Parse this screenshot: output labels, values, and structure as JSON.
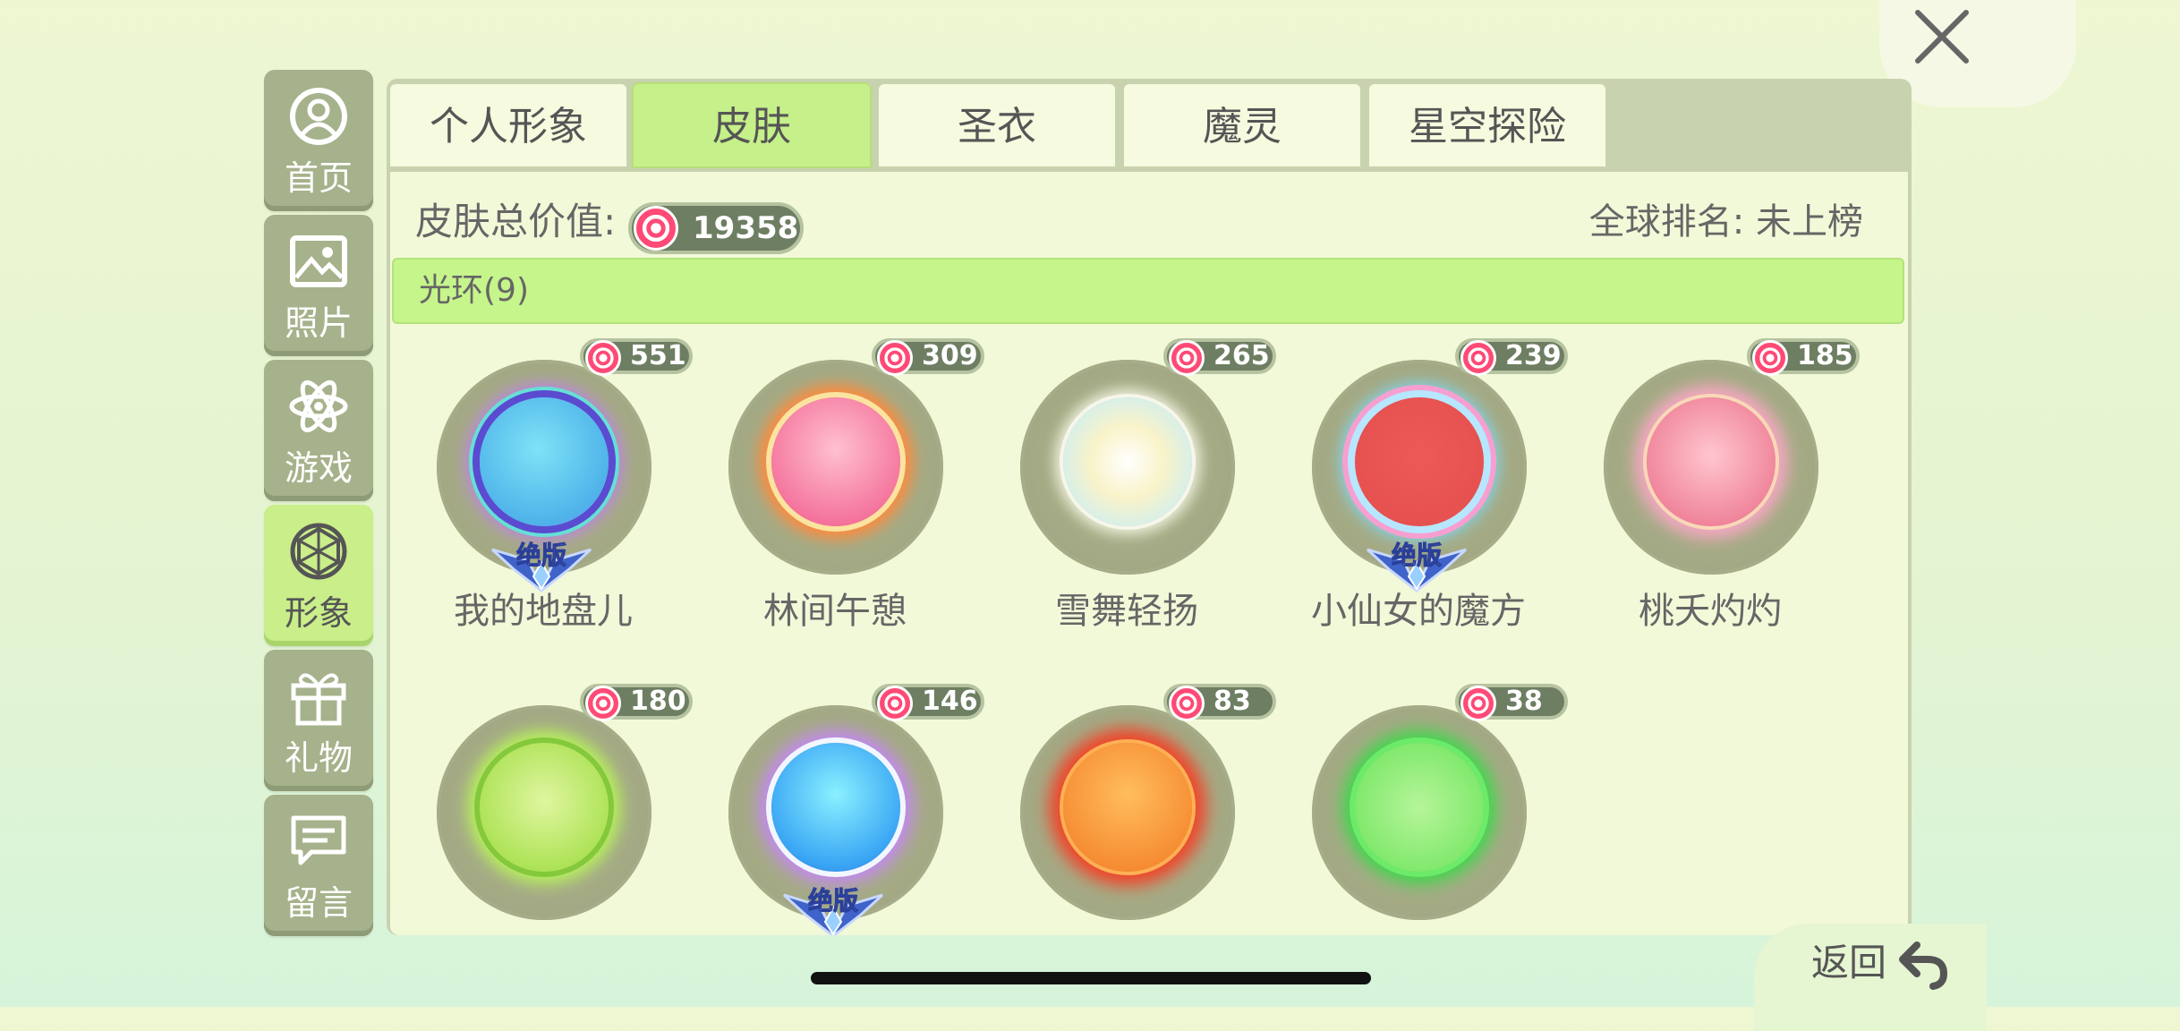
{
  "sidebar": {
    "items": [
      {
        "label": "首页",
        "icon": "user-circle-icon"
      },
      {
        "label": "照片",
        "icon": "photo-icon"
      },
      {
        "label": "游戏",
        "icon": "atom-icon"
      },
      {
        "label": "形象",
        "icon": "gem-icon",
        "active": true
      },
      {
        "label": "礼物",
        "icon": "gift-icon"
      },
      {
        "label": "留言",
        "icon": "message-icon"
      }
    ]
  },
  "tabs": [
    {
      "label": "个人形象"
    },
    {
      "label": "皮肤",
      "active": true
    },
    {
      "label": "圣衣"
    },
    {
      "label": "魔灵"
    },
    {
      "label": "星空探险"
    }
  ],
  "summary": {
    "total_label": "皮肤总价值:",
    "total_value": "19358",
    "rank_text": "全球排名: 未上榜"
  },
  "section": {
    "title": "光环(9)"
  },
  "items": [
    {
      "name": "我的地盘儿",
      "price": "551",
      "badge": "绝版"
    },
    {
      "name": "林间午憩",
      "price": "309"
    },
    {
      "name": "雪舞轻扬",
      "price": "265"
    },
    {
      "name": "小仙女的魔方",
      "price": "239",
      "badge": "绝版"
    },
    {
      "name": "桃夭灼灼",
      "price": "185"
    },
    {
      "name": "",
      "price": "180"
    },
    {
      "name": "",
      "price": "146",
      "badge": "绝版"
    },
    {
      "name": "",
      "price": "83"
    },
    {
      "name": "",
      "price": "38"
    }
  ],
  "back": {
    "label": "返回"
  },
  "colors": {
    "accent_green": "#c6f08a",
    "sidebar_olive": "#a6b28b",
    "coin_pink": "#ff4a76"
  }
}
